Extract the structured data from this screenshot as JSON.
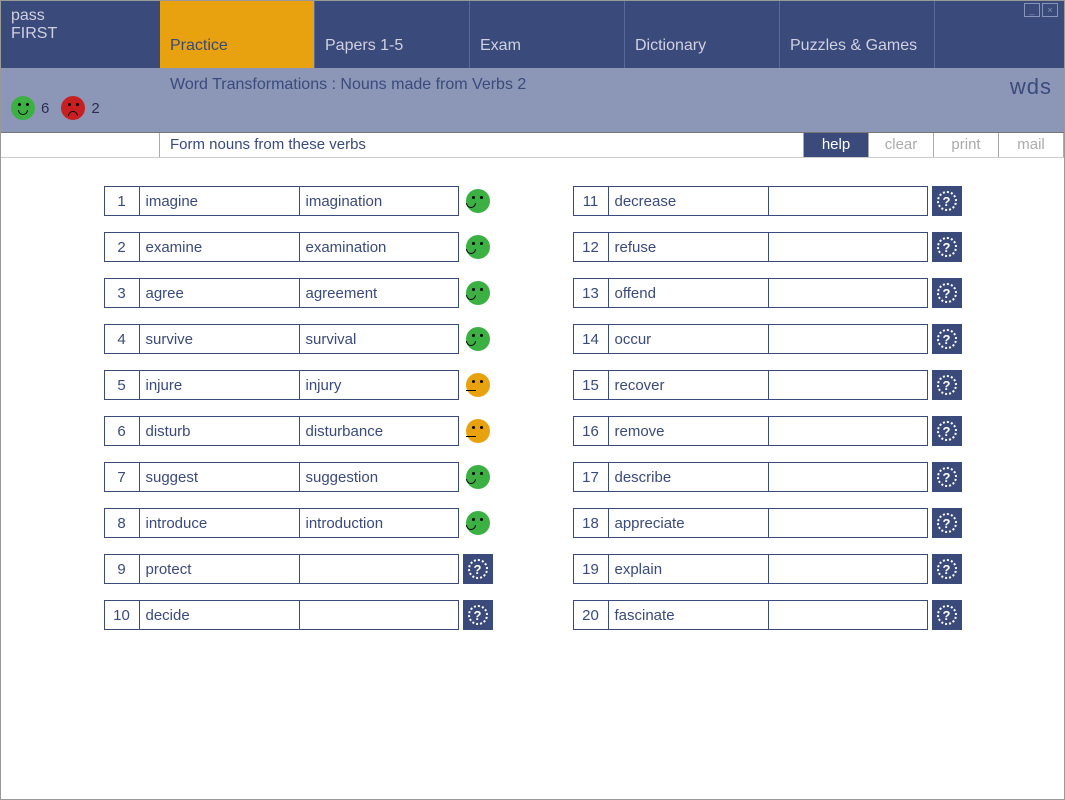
{
  "logo": {
    "line1": "pass",
    "line2": "FIRST"
  },
  "tabs": [
    {
      "label": "Practice",
      "active": true
    },
    {
      "label": "Papers 1-5",
      "active": false
    },
    {
      "label": "Exam",
      "active": false
    },
    {
      "label": "Dictionary",
      "active": false
    },
    {
      "label": "Puzzles & Games",
      "active": false
    }
  ],
  "score": {
    "correct": "6",
    "wrong": "2"
  },
  "subtitle": "Word Transformations : Nouns made from Verbs 2",
  "brand": "wds",
  "instruction": "Form nouns from these verbs",
  "buttons": {
    "help": "help",
    "clear": "clear",
    "print": "print",
    "mail": "mail"
  },
  "rows_left": [
    {
      "n": "1",
      "verb": "imagine",
      "ans": "imagination",
      "state": "green"
    },
    {
      "n": "2",
      "verb": "examine",
      "ans": "examination",
      "state": "green"
    },
    {
      "n": "3",
      "verb": "agree",
      "ans": "agreement",
      "state": "green"
    },
    {
      "n": "4",
      "verb": "survive",
      "ans": "survival",
      "state": "green"
    },
    {
      "n": "5",
      "verb": "injure",
      "ans": "injury",
      "state": "orange"
    },
    {
      "n": "6",
      "verb": "disturb",
      "ans": "disturbance",
      "state": "orange"
    },
    {
      "n": "7",
      "verb": "suggest",
      "ans": "suggestion",
      "state": "green"
    },
    {
      "n": "8",
      "verb": "introduce",
      "ans": "introduction",
      "state": "green"
    },
    {
      "n": "9",
      "verb": "protect",
      "ans": "",
      "state": "q"
    },
    {
      "n": "10",
      "verb": "decide",
      "ans": "",
      "state": "q"
    }
  ],
  "rows_right": [
    {
      "n": "11",
      "verb": "decrease",
      "ans": "",
      "state": "q"
    },
    {
      "n": "12",
      "verb": "refuse",
      "ans": "",
      "state": "q"
    },
    {
      "n": "13",
      "verb": "offend",
      "ans": "",
      "state": "q"
    },
    {
      "n": "14",
      "verb": "occur",
      "ans": "",
      "state": "q"
    },
    {
      "n": "15",
      "verb": "recover",
      "ans": "",
      "state": "q"
    },
    {
      "n": "16",
      "verb": "remove",
      "ans": "",
      "state": "q"
    },
    {
      "n": "17",
      "verb": "describe",
      "ans": "",
      "state": "q"
    },
    {
      "n": "18",
      "verb": "appreciate",
      "ans": "",
      "state": "q"
    },
    {
      "n": "19",
      "verb": "explain",
      "ans": "",
      "state": "q"
    },
    {
      "n": "20",
      "verb": "fascinate",
      "ans": "",
      "state": "q"
    }
  ]
}
